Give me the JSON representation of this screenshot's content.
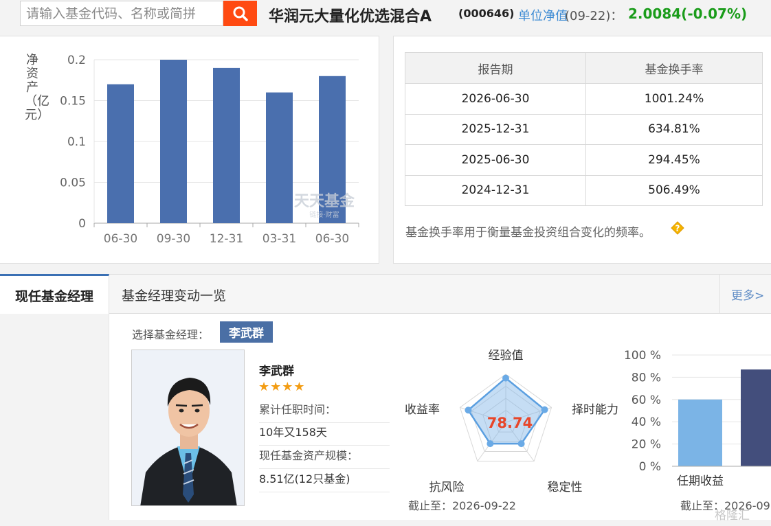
{
  "search": {
    "placeholder": "请输入基金代码、名称或简拼"
  },
  "fund": {
    "name": "华润元大量化优选混合A",
    "code": "(000646)",
    "nav_label": "单位净值",
    "nav_date": "(09-22)：",
    "nav_value": "2.0084(-0.07%)"
  },
  "asset_chart": {
    "ylabel": "净资产（亿元）",
    "watermark": "天天基金",
    "watermark_sub": "链接·财富"
  },
  "chart_data": {
    "type": "bar",
    "categories": [
      "06-30",
      "09-30",
      "12-31",
      "03-31",
      "06-30"
    ],
    "values": [
      0.17,
      0.2,
      0.19,
      0.16,
      0.18
    ],
    "ylim": [
      0,
      0.2
    ],
    "yticks": [
      "0",
      "0.05",
      "0.1",
      "0.15",
      "0.2"
    ],
    "ylabel": "净资产（亿元）",
    "color": "#4a6fae",
    "grid": true
  },
  "turnover": {
    "headers": [
      "报告期",
      "基金换手率"
    ],
    "rows": [
      [
        "2026-06-30",
        "1001.24%"
      ],
      [
        "2025-12-31",
        "634.81%"
      ],
      [
        "2025-06-30",
        "294.45%"
      ],
      [
        "2024-12-31",
        "506.49%"
      ]
    ],
    "note": "基金换手率用于衡量基金投资组合变化的频率。"
  },
  "manager_tabs": {
    "active": "现任基金经理",
    "inactive": "基金经理变动一览",
    "more": "更多>"
  },
  "manager": {
    "select_label": "选择基金经理：",
    "chip": "李武群",
    "name": "李武群",
    "stars": "★★★★",
    "tenure_label": "累计任职时间：",
    "tenure_value": "10年又158天",
    "asset_label": "现任基金资产规模：",
    "asset_value": "8.51亿(12只基金)"
  },
  "radar": {
    "score": "78.74",
    "axes": [
      "经验值",
      "择时能力",
      "稳定性",
      "抗风险",
      "收益率"
    ],
    "values": [
      0.92,
      0.85,
      0.55,
      0.55,
      0.82
    ],
    "caption": "截止至：2026-09-22",
    "color": "#7fb3e6"
  },
  "return_bar": {
    "yticks": [
      "0 %",
      "20 %",
      "40 %",
      "60 %",
      "80 %",
      "100 %"
    ],
    "category": "任期收益",
    "values": [
      0.6,
      0.87
    ],
    "colors": [
      "#7bb4e6",
      "#434e7c"
    ],
    "caption": "截止至：2026-09"
  },
  "footer_watermark": "格隆汇"
}
